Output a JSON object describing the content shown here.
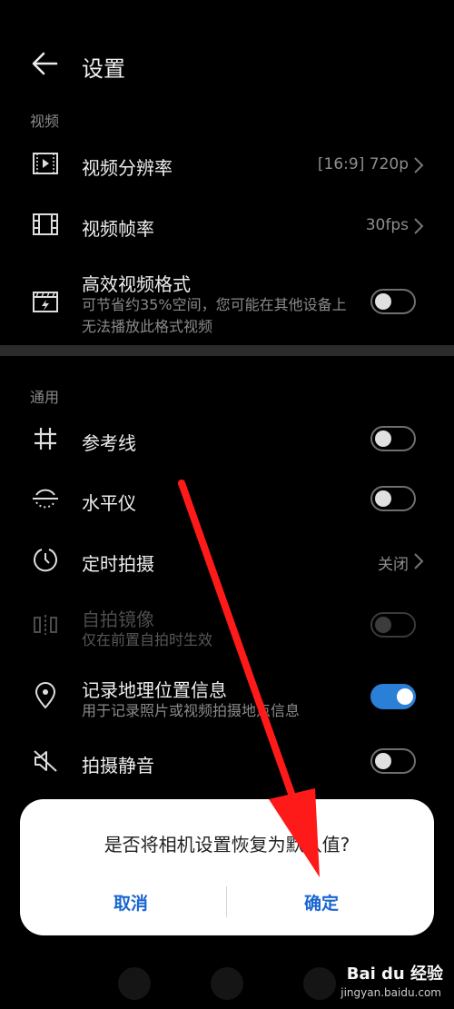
{
  "header": {
    "title": "设置",
    "back_icon": "back-arrow-icon"
  },
  "sections": {
    "video": "视频",
    "general": "通用"
  },
  "video_items": {
    "resolution": {
      "label": "视频分辨率",
      "value": "[16:9] 720p",
      "icon": "video-resolution-icon"
    },
    "framerate": {
      "label": "视频帧率",
      "value": "30fps",
      "icon": "film-icon"
    },
    "efficient": {
      "label": "高效视频格式",
      "sub": "可节省约35%空间，您可能在其他设备上无法播放此格式视频",
      "toggle": false,
      "icon": "efficient-format-icon"
    }
  },
  "general_items": {
    "gridlines": {
      "label": "参考线",
      "toggle": false,
      "icon": "grid-icon"
    },
    "level": {
      "label": "水平仪",
      "toggle": false,
      "icon": "level-icon"
    },
    "timer": {
      "label": "定时拍摄",
      "value": "关闭",
      "icon": "timer-icon"
    },
    "mirror": {
      "label": "自拍镜像",
      "sub": "仅在前置自拍时生效",
      "toggle": false,
      "disabled": true,
      "icon": "mirror-icon"
    },
    "location": {
      "label": "记录地理位置信息",
      "sub": "用于记录照片或视频拍摄地点信息",
      "toggle": true,
      "icon": "location-icon"
    },
    "mute": {
      "label": "拍摄静音",
      "toggle": false,
      "icon": "mute-icon"
    }
  },
  "dialog": {
    "message": "是否将相机设置恢复为默认值?",
    "cancel": "取消",
    "confirm": "确定"
  },
  "watermark": {
    "brand": "Bai du 经验",
    "url": "jingyan.baidu.com"
  },
  "colors": {
    "accent": "#2a7fd6",
    "dialog_button": "#1a66d1",
    "arrow": "#ff1a1a"
  }
}
